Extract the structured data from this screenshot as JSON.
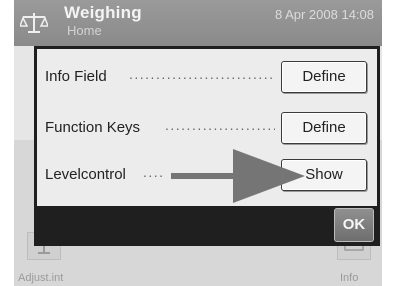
{
  "header": {
    "title": "Weighing",
    "subtitle": "Home",
    "datetime": "8 Apr 2008  14:08"
  },
  "dialog": {
    "rows": [
      {
        "label": "Info Field",
        "dots": "........................................",
        "button": "Define"
      },
      {
        "label": "Function Keys",
        "dots": "...........................",
        "button": "Define"
      },
      {
        "label": "Levelcontrol",
        "dots": "....",
        "button": "Show"
      }
    ],
    "ok_label": "OK"
  },
  "bottom": {
    "left_label": "Adjust.int",
    "right_label": "Info"
  },
  "icons": {
    "app": "balance-scale-icon",
    "bottom_left": "adjust-int-icon",
    "bottom_right": "info-icon"
  },
  "colors": {
    "header_bg": "#8f8f8f",
    "dialog_frame": "#1f1f1f",
    "ok_bg": "#7a7a7a",
    "arrow": "#757575"
  }
}
